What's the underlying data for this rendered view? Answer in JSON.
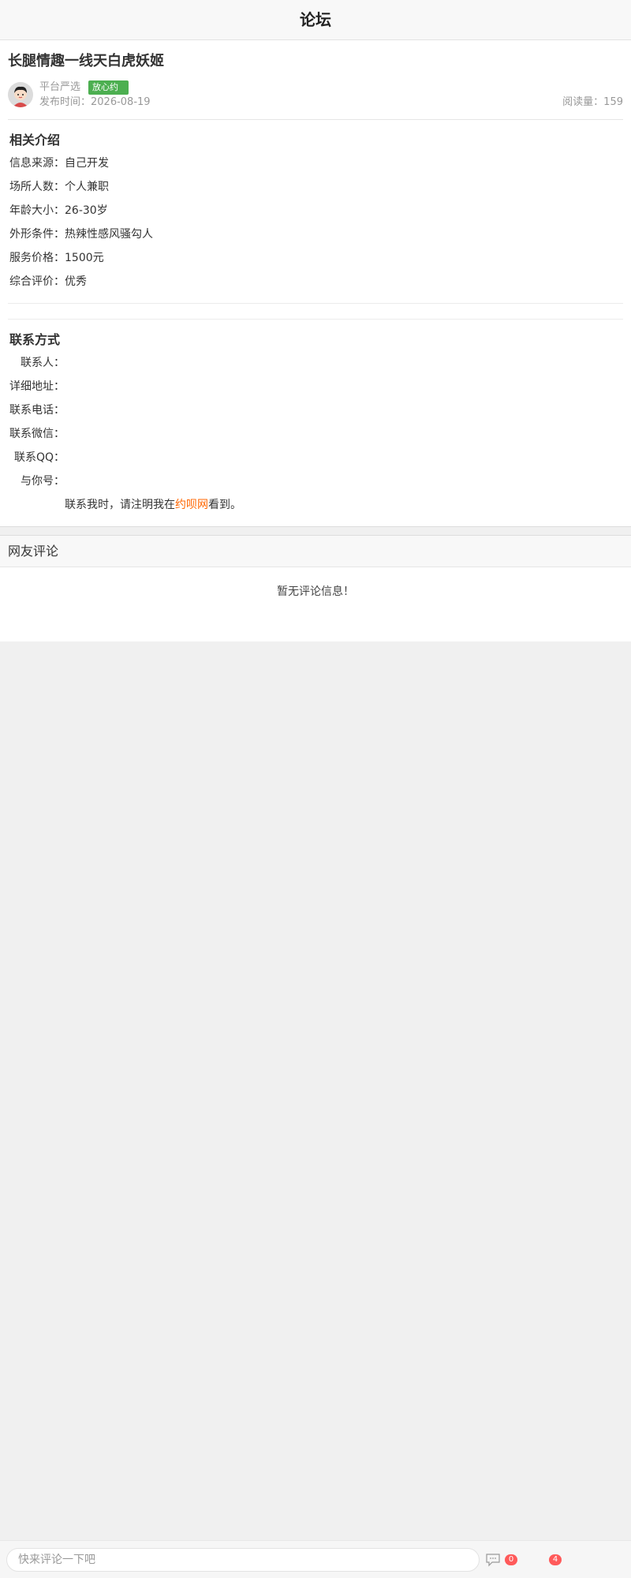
{
  "header": {
    "title": "论坛"
  },
  "post": {
    "title": "长腿情趣一线天白虎妖姬",
    "author": "平台严选",
    "badge": "放心约",
    "publish_time": "发布时间：2026-08-19",
    "read_count": "阅读量：159"
  },
  "intro": {
    "title": "相关介绍",
    "rows": [
      {
        "label": "信息来源：",
        "value": "自己开发"
      },
      {
        "label": "场所人数：",
        "value": "个人兼职"
      },
      {
        "label": "年龄大小：",
        "value": "26-30岁"
      },
      {
        "label": "外形条件：",
        "value": "热辣性感风骚勾人"
      },
      {
        "label": "服务价格：",
        "value": "1500元"
      },
      {
        "label": "综合评价：",
        "value": "优秀"
      }
    ]
  },
  "contact": {
    "title": "联系方式",
    "rows": [
      {
        "label": "联系人：",
        "value": ""
      },
      {
        "label": "详细地址：",
        "value": ""
      },
      {
        "label": "联系电话：",
        "value": ""
      },
      {
        "label": "联系微信：",
        "value": ""
      },
      {
        "label": "联系QQ：",
        "value": ""
      },
      {
        "label": "与你号：",
        "value": ""
      }
    ],
    "note_prefix": "联系我时，请注明我在",
    "note_site": "约呗网",
    "note_suffix": "看到。"
  },
  "comments": {
    "title": "网友评论",
    "empty_text": "暂无评论信息！"
  },
  "bottom_bar": {
    "input_placeholder": "快来评论一下吧",
    "comment_count": "0",
    "like_count": "4",
    "icons": [
      "comment-icon"
    ]
  }
}
